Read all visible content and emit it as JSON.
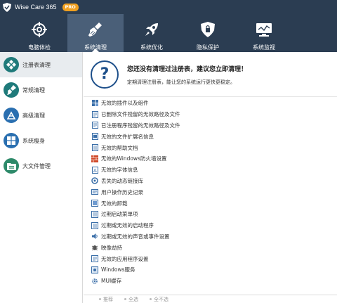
{
  "titlebar": {
    "app_title": "Wise Care 365",
    "badge": "PRO"
  },
  "nav": [
    {
      "label": "电脑体检",
      "icon": "crosshair-icon"
    },
    {
      "label": "系统清理",
      "icon": "broom-icon"
    },
    {
      "label": "系统优化",
      "icon": "rocket-icon"
    },
    {
      "label": "隐私保护",
      "icon": "shield-lock-icon"
    },
    {
      "label": "系统监视",
      "icon": "monitor-icon"
    }
  ],
  "sidebar": [
    {
      "label": "注册表清理",
      "icon": "registry-icon"
    },
    {
      "label": "常规清理",
      "icon": "broom-icon"
    },
    {
      "label": "高级清理",
      "icon": "magnifier-icon"
    },
    {
      "label": "系统瘦身",
      "icon": "windows-icon"
    },
    {
      "label": "大文件管理",
      "icon": "folder-icon"
    }
  ],
  "header": {
    "title": "您还没有清理过注册表，建议您立即清理！",
    "subtitle": "定期清理注册表，能让您的系统运行更快更稳定。"
  },
  "items": [
    "无效的插件以及组件",
    "已删除文件残留的无效路径及文件",
    "已注册程序残留的无效路径及文件",
    "无效的文件扩展名信息",
    "无效的帮助文档",
    "无效的Windows防火墙设置",
    "无效的字体信息",
    "丢失的动态链接库",
    "用户操作历史记录",
    "无效的卸载",
    "过期启动菜单项",
    "过期或无效的启动程序",
    "过期或无效的声音或事件设置",
    "映像劫持",
    "无效的应用程序设置",
    "Windows服务",
    "MUI缓存"
  ],
  "footer": {
    "recommend": "推荐",
    "select_all": "全选",
    "select_none": "全不选"
  },
  "colors": {
    "titlebar": "#2b3d52",
    "nav_active": "#4a5f78",
    "accent": "#1d4f8a",
    "badge": "#f0a020"
  }
}
